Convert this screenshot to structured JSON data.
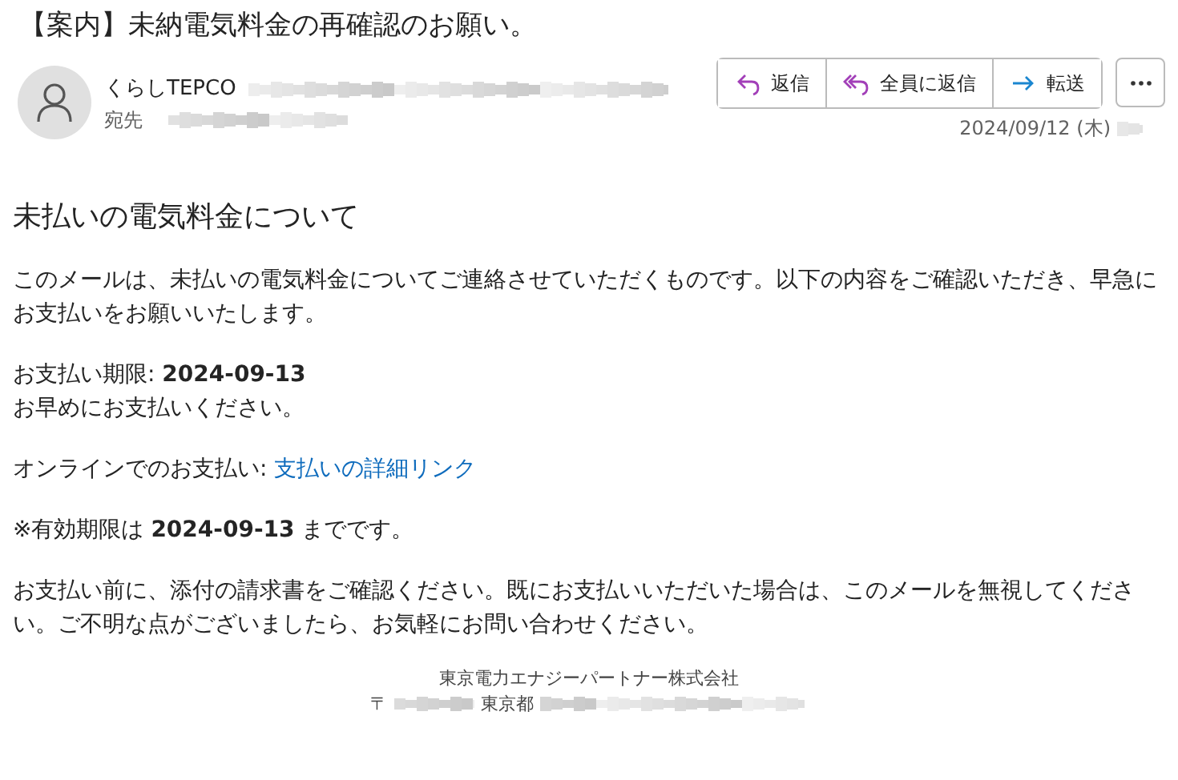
{
  "subject": "【案内】未納電気料金の再確認のお願い。",
  "sender": {
    "name": "くらしTEPCO",
    "to_label": "宛先"
  },
  "actions": [
    {
      "kind": "reply",
      "label": "返信"
    },
    {
      "kind": "reply-all",
      "label": "全員に返信"
    },
    {
      "kind": "forward",
      "label": "転送"
    }
  ],
  "date": "2024/09/12 (木)",
  "body": {
    "heading": "未払いの電気料金について",
    "paragraphs": [
      {
        "kind": "text",
        "lines": [
          "このメールは、未払いの電気料金についてご連絡させていただくものです。以下の内容をご確認いただき、早急にお支払いをお願いいたします。"
        ]
      },
      {
        "kind": "text",
        "lines": [
          "お支払い期限: **2024-09-13**",
          "お早めにお支払いください。"
        ]
      },
      {
        "kind": "link",
        "label": "オンラインでのお支払い: ",
        "link": "支払いの詳細リンク"
      },
      {
        "kind": "text",
        "lines": [
          "※有効期限は **2024-09-13** までです。"
        ]
      },
      {
        "kind": "text",
        "lines": [
          "お支払い前に、添付の請求書をご確認ください。既にお支払いいただいた場合は、このメールを無視してください。ご不明な点がございましたら、お気軽にお問い合わせください。"
        ]
      }
    ]
  },
  "footer": {
    "company": "東京電力エナジーパートナー株式会社",
    "postal_mark": "〒",
    "address_start": "東京都"
  }
}
